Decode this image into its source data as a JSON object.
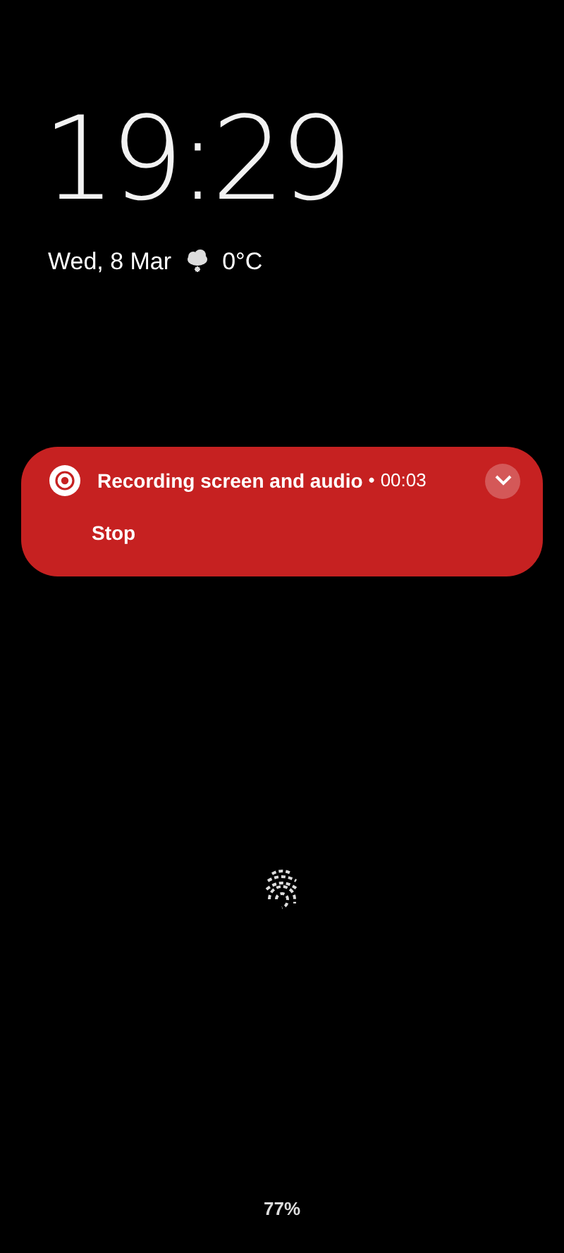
{
  "clock": {
    "time": "19:29",
    "date": "Wed, 8 Mar",
    "temperature": "0°C"
  },
  "notification": {
    "title": "Recording screen and audio",
    "separator": "•",
    "elapsed": "00:03",
    "action": "Stop",
    "expanded": false
  },
  "battery": {
    "percent": "77%"
  }
}
